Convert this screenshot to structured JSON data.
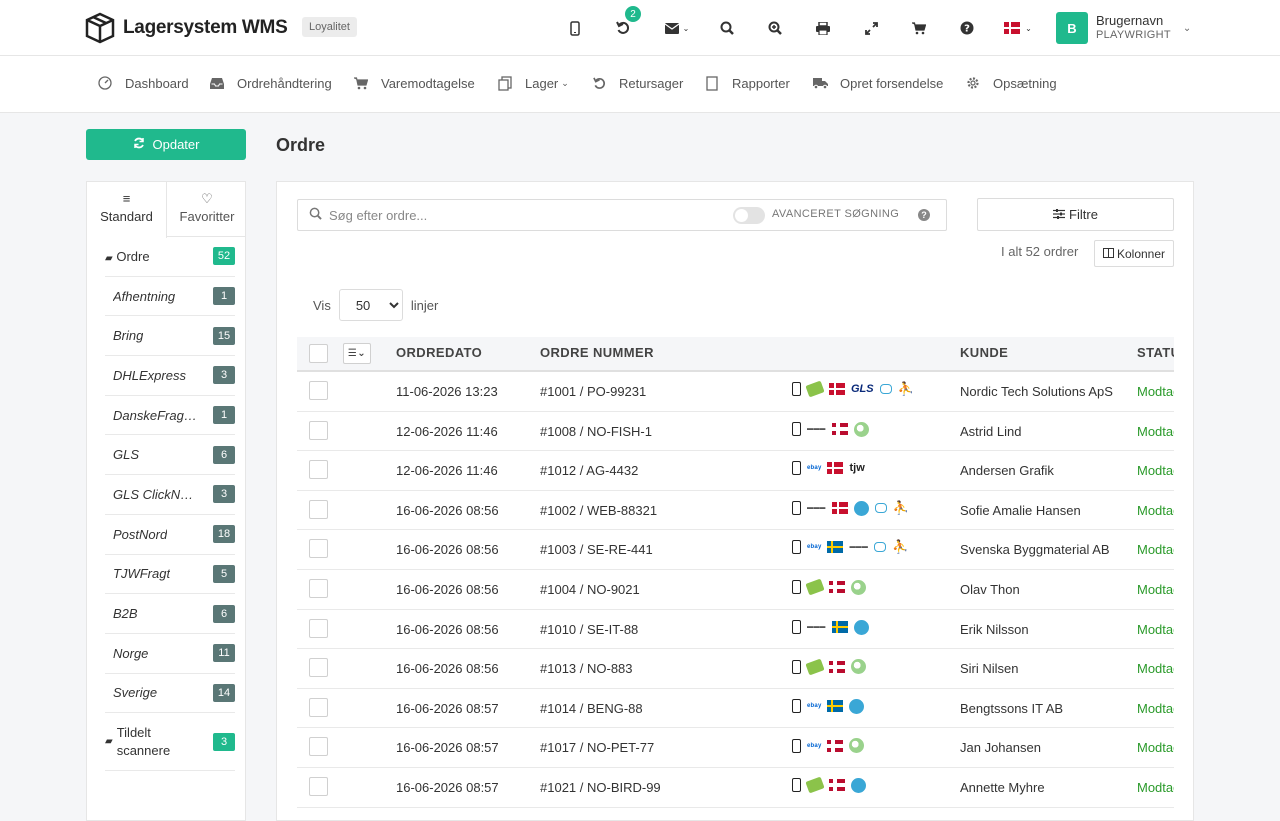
{
  "header": {
    "logo_text": "Lagersystem WMS",
    "loyalty_badge": "Loyalitet",
    "notification_count": "2",
    "user_initial": "B",
    "user_name": "Brugernavn",
    "user_company": "PLAYWRIGHT"
  },
  "nav": {
    "items": [
      {
        "label": "Dashboard",
        "icon": "dashboard-icon"
      },
      {
        "label": "Ordrehåndtering",
        "icon": "inbox-icon"
      },
      {
        "label": "Varemodtagelse",
        "icon": "cart-icon"
      },
      {
        "label": "Lager",
        "icon": "copy-icon"
      },
      {
        "label": "Retursager",
        "icon": "undo-icon"
      },
      {
        "label": "Rapporter",
        "icon": "document-icon"
      },
      {
        "label": "Opret forsendelse",
        "icon": "truck-icon"
      },
      {
        "label": "Opsætning",
        "icon": "gear-icon"
      }
    ]
  },
  "sidebar": {
    "update_button": "Opdater",
    "tabs": [
      "Standard",
      "Favoritter"
    ],
    "items": [
      {
        "label": "Ordre",
        "count": "52",
        "main": true
      },
      {
        "label": "Afhentning",
        "count": "1"
      },
      {
        "label": "Bring",
        "count": "15"
      },
      {
        "label": "DHLExpress",
        "count": "3"
      },
      {
        "label": "DanskeFragtmænd",
        "count": "1"
      },
      {
        "label": "GLS",
        "count": "6"
      },
      {
        "label": "GLS ClickNShip",
        "count": "3"
      },
      {
        "label": "PostNord",
        "count": "18"
      },
      {
        "label": "TJWFragt",
        "count": "5"
      },
      {
        "label": "B2B",
        "count": "6"
      },
      {
        "label": "Norge",
        "count": "11"
      },
      {
        "label": "Sverige",
        "count": "14"
      },
      {
        "label": "Tildelt scannere",
        "count": "3",
        "main": true
      }
    ]
  },
  "main": {
    "title": "Ordre",
    "search_placeholder": "Søg efter ordre...",
    "advanced_search": "AVANCERET SØGNING",
    "filter_button": "Filtre",
    "total": "I alt 52 ordrer",
    "columns_button": "Kolonner",
    "show_label": "Vis",
    "show_value": "50",
    "lines_label": "linjer",
    "columns": {
      "date": "ORDREDATO",
      "number": "ORDRE NUMMER",
      "customer": "KUNDE",
      "status": "STATUS"
    },
    "rows": [
      {
        "date": "11-06-2026 13:23",
        "number": "#1001 / PO-99231",
        "customer": "Nordic Tech Solutions ApS",
        "status": "Modtaget",
        "icons": [
          "phone",
          "money",
          "flag-dk",
          "gls",
          "chat",
          "person"
        ]
      },
      {
        "date": "12-06-2026 11:46",
        "number": "#1008 / NO-FISH-1",
        "customer": "Astrid Lind",
        "status": "Modtaget",
        "icons": [
          "phone",
          "tiny",
          "flag-no",
          "circle-green"
        ]
      },
      {
        "date": "12-06-2026 11:46",
        "number": "#1012 / AG-4432",
        "customer": "Andersen Grafik",
        "status": "Modtaget",
        "icons": [
          "phone",
          "ebay",
          "flag-dk",
          "tjw"
        ]
      },
      {
        "date": "16-06-2026 08:56",
        "number": "#1002 / WEB-88321",
        "customer": "Sofie Amalie Hansen",
        "status": "Modtaget",
        "icons": [
          "phone",
          "tiny",
          "flag-dk",
          "circle-blue",
          "chat",
          "person"
        ]
      },
      {
        "date": "16-06-2026 08:56",
        "number": "#1003 / SE-RE-441",
        "customer": "Svenska Byggmaterial AB",
        "status": "Modtaget",
        "icons": [
          "phone",
          "ebay",
          "flag-se",
          "tiny",
          "chat",
          "person"
        ]
      },
      {
        "date": "16-06-2026 08:56",
        "number": "#1004 / NO-9021",
        "customer": "Olav Thon",
        "status": "Modtaget",
        "icons": [
          "phone",
          "money",
          "flag-no",
          "circle-green"
        ]
      },
      {
        "date": "16-06-2026 08:56",
        "number": "#1010 / SE-IT-88",
        "customer": "Erik Nilsson",
        "status": "Modtaget",
        "icons": [
          "phone",
          "tiny",
          "flag-se",
          "circle-blue"
        ]
      },
      {
        "date": "16-06-2026 08:56",
        "number": "#1013 / NO-883",
        "customer": "Siri Nilsen",
        "status": "Modtaget",
        "icons": [
          "phone",
          "money",
          "flag-no",
          "circle-green"
        ]
      },
      {
        "date": "16-06-2026 08:57",
        "number": "#1014 / BENG-88",
        "customer": "Bengtssons IT AB",
        "status": "Modtaget",
        "icons": [
          "phone",
          "ebay",
          "flag-se",
          "circle-blue"
        ]
      },
      {
        "date": "16-06-2026 08:57",
        "number": "#1017 / NO-PET-77",
        "customer": "Jan Johansen",
        "status": "Modtaget",
        "icons": [
          "phone",
          "ebay",
          "flag-no",
          "circle-green"
        ]
      },
      {
        "date": "16-06-2026 08:57",
        "number": "#1021 / NO-BIRD-99",
        "customer": "Annette Myhre",
        "status": "Modtaget",
        "icons": [
          "phone",
          "money",
          "flag-no",
          "circle-blue"
        ]
      }
    ]
  },
  "colors": {
    "accent": "#20b98d",
    "badge": "#5a7776",
    "status": "#2a9a2a"
  }
}
